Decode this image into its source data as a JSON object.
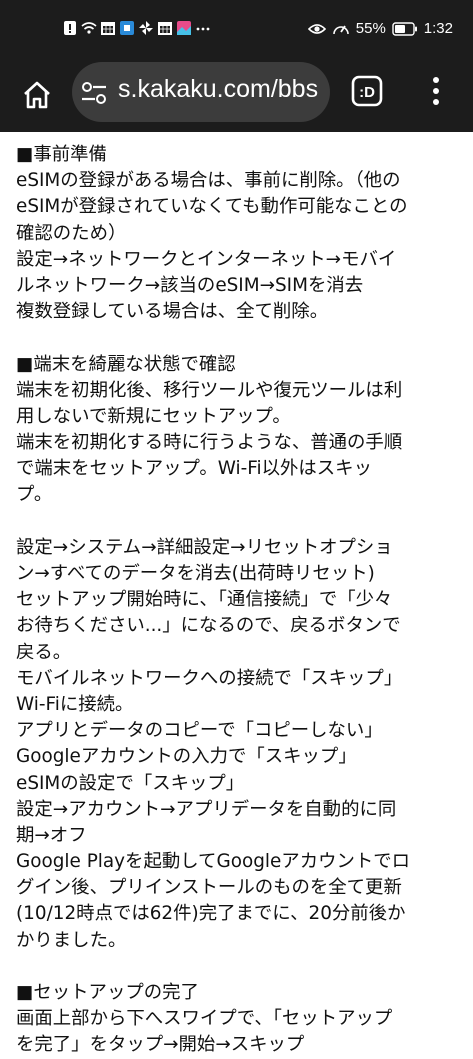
{
  "status_bar": {
    "battery": "55%",
    "time": "1:32"
  },
  "toolbar": {
    "url": "s.kakaku.com/bbs"
  },
  "article": {
    "lines": [
      "■事前準備",
      "eSIMの登録がある場合は、事前に削除。（他の",
      "eSIMが登録されていなくても動作可能なことの",
      "確認のため）",
      "設定→ネットワークとインターネット→モバイ",
      "ルネットワーク→該当のeSIM→SIMを消去",
      "複数登録している場合は、全て削除。",
      "",
      "■端末を綺麗な状態で確認",
      "端末を初期化後、移行ツールや復元ツールは利",
      "用しないで新規にセットアップ。",
      "端末を初期化する時に行うような、普通の手順",
      "で端末をセットアップ。Wi-Fi以外はスキッ",
      "プ。",
      "",
      "設定→システム→詳細設定→リセットオプショ",
      "ン→すべてのデータを消去(出荷時リセット)",
      "セットアップ開始時に、「通信接続」で「少々",
      "お待ちください...」になるので、戻るボタンで",
      "戻る。",
      "モバイルネットワークへの接続で「スキップ」",
      "Wi-Fiに接続。",
      "アプリとデータのコピーで「コピーしない」",
      "Googleアカウントの入力で「スキップ」",
      "eSIMの設定で「スキップ」",
      "設定→アカウント→アプリデータを自動的に同",
      "期→オフ",
      "Google Playを起動してGoogleアカウントでロ",
      "グイン後、プリインストールのものを全て更新",
      "(10/12時点では62件)完了までに、20分前後か",
      "かりました。",
      "",
      "■セットアップの完了",
      "画面上部から下へスワイプで、「セットアップ",
      "を完了」をタップ→開始→スキップ"
    ]
  }
}
